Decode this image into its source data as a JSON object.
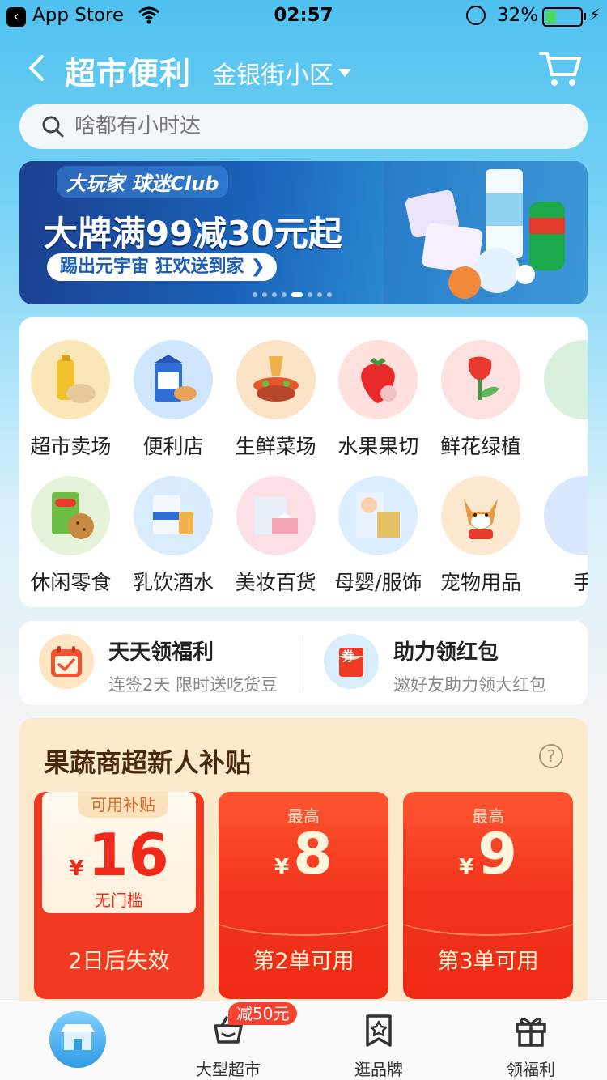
{
  "status_bar": {
    "back_app": "App Store",
    "time": "02:57",
    "battery": "32%"
  },
  "header": {
    "title": "超市便利",
    "location": "金银街小区"
  },
  "search": {
    "placeholder": "啥都有小时达"
  },
  "banner": {
    "club": "大玩家 球迷Club",
    "title": "大牌满99减30元起",
    "cta": "踢出元宇宙 狂欢送到家 ❯",
    "dots": 8,
    "active_dot": 4
  },
  "categories": {
    "row1": [
      {
        "label": "超市卖场",
        "icon": "cooking-oil-icon",
        "color": "#fbe6b8"
      },
      {
        "label": "便利店",
        "icon": "milk-carton-icon",
        "color": "#cfe6ff"
      },
      {
        "label": "生鲜菜场",
        "icon": "hotpot-icon",
        "color": "#fde3c6"
      },
      {
        "label": "水果果切",
        "icon": "strawberry-icon",
        "color": "#ffe0dc"
      },
      {
        "label": "鲜花绿植",
        "icon": "tulip-icon",
        "color": "#fde0e0"
      },
      {
        "label": "",
        "icon": "more-icon",
        "color": "#d7f1de"
      }
    ],
    "row2": [
      {
        "label": "休闲零食",
        "icon": "chips-icon",
        "color": "#e6f3d8"
      },
      {
        "label": "乳饮酒水",
        "icon": "milk-box-icon",
        "color": "#d9ecff"
      },
      {
        "label": "美妆百货",
        "icon": "tissue-icon",
        "color": "#fde0e6"
      },
      {
        "label": "母婴/服饰",
        "icon": "baby-icon",
        "color": "#dbeeff"
      },
      {
        "label": "宠物用品",
        "icon": "shiba-dog-icon",
        "color": "#fde9cf"
      },
      {
        "label": "手",
        "icon": "phone-icon",
        "color": "#d9e8ff"
      }
    ]
  },
  "welfare": [
    {
      "title": "天天领福利",
      "subtitle": "连签2天 限时送吃货豆",
      "icon": "calendar-check-icon"
    },
    {
      "title": "助力领红包",
      "subtitle": "邀好友助力领大红包",
      "icon": "red-envelope-icon",
      "icon_text": "券"
    }
  ],
  "subsidy": {
    "title": "果蔬商超新人补贴",
    "coupons": [
      {
        "tag": "可用补贴",
        "symbol": "¥",
        "amount": "16",
        "condition": "无门槛",
        "footer": "2日后失效"
      },
      {
        "top": "最高",
        "symbol": "¥",
        "amount": "8",
        "footer": "第2单可用"
      },
      {
        "top": "最高",
        "symbol": "¥",
        "amount": "9",
        "footer": "第3单可用"
      }
    ]
  },
  "tabbar": {
    "badge": "减50元",
    "tabs": [
      {
        "label": "",
        "icon": "store-home-icon"
      },
      {
        "label": "大型超市",
        "icon": "basket-icon"
      },
      {
        "label": "逛品牌",
        "icon": "brand-star-icon"
      },
      {
        "label": "领福利",
        "icon": "gift-icon"
      }
    ]
  }
}
